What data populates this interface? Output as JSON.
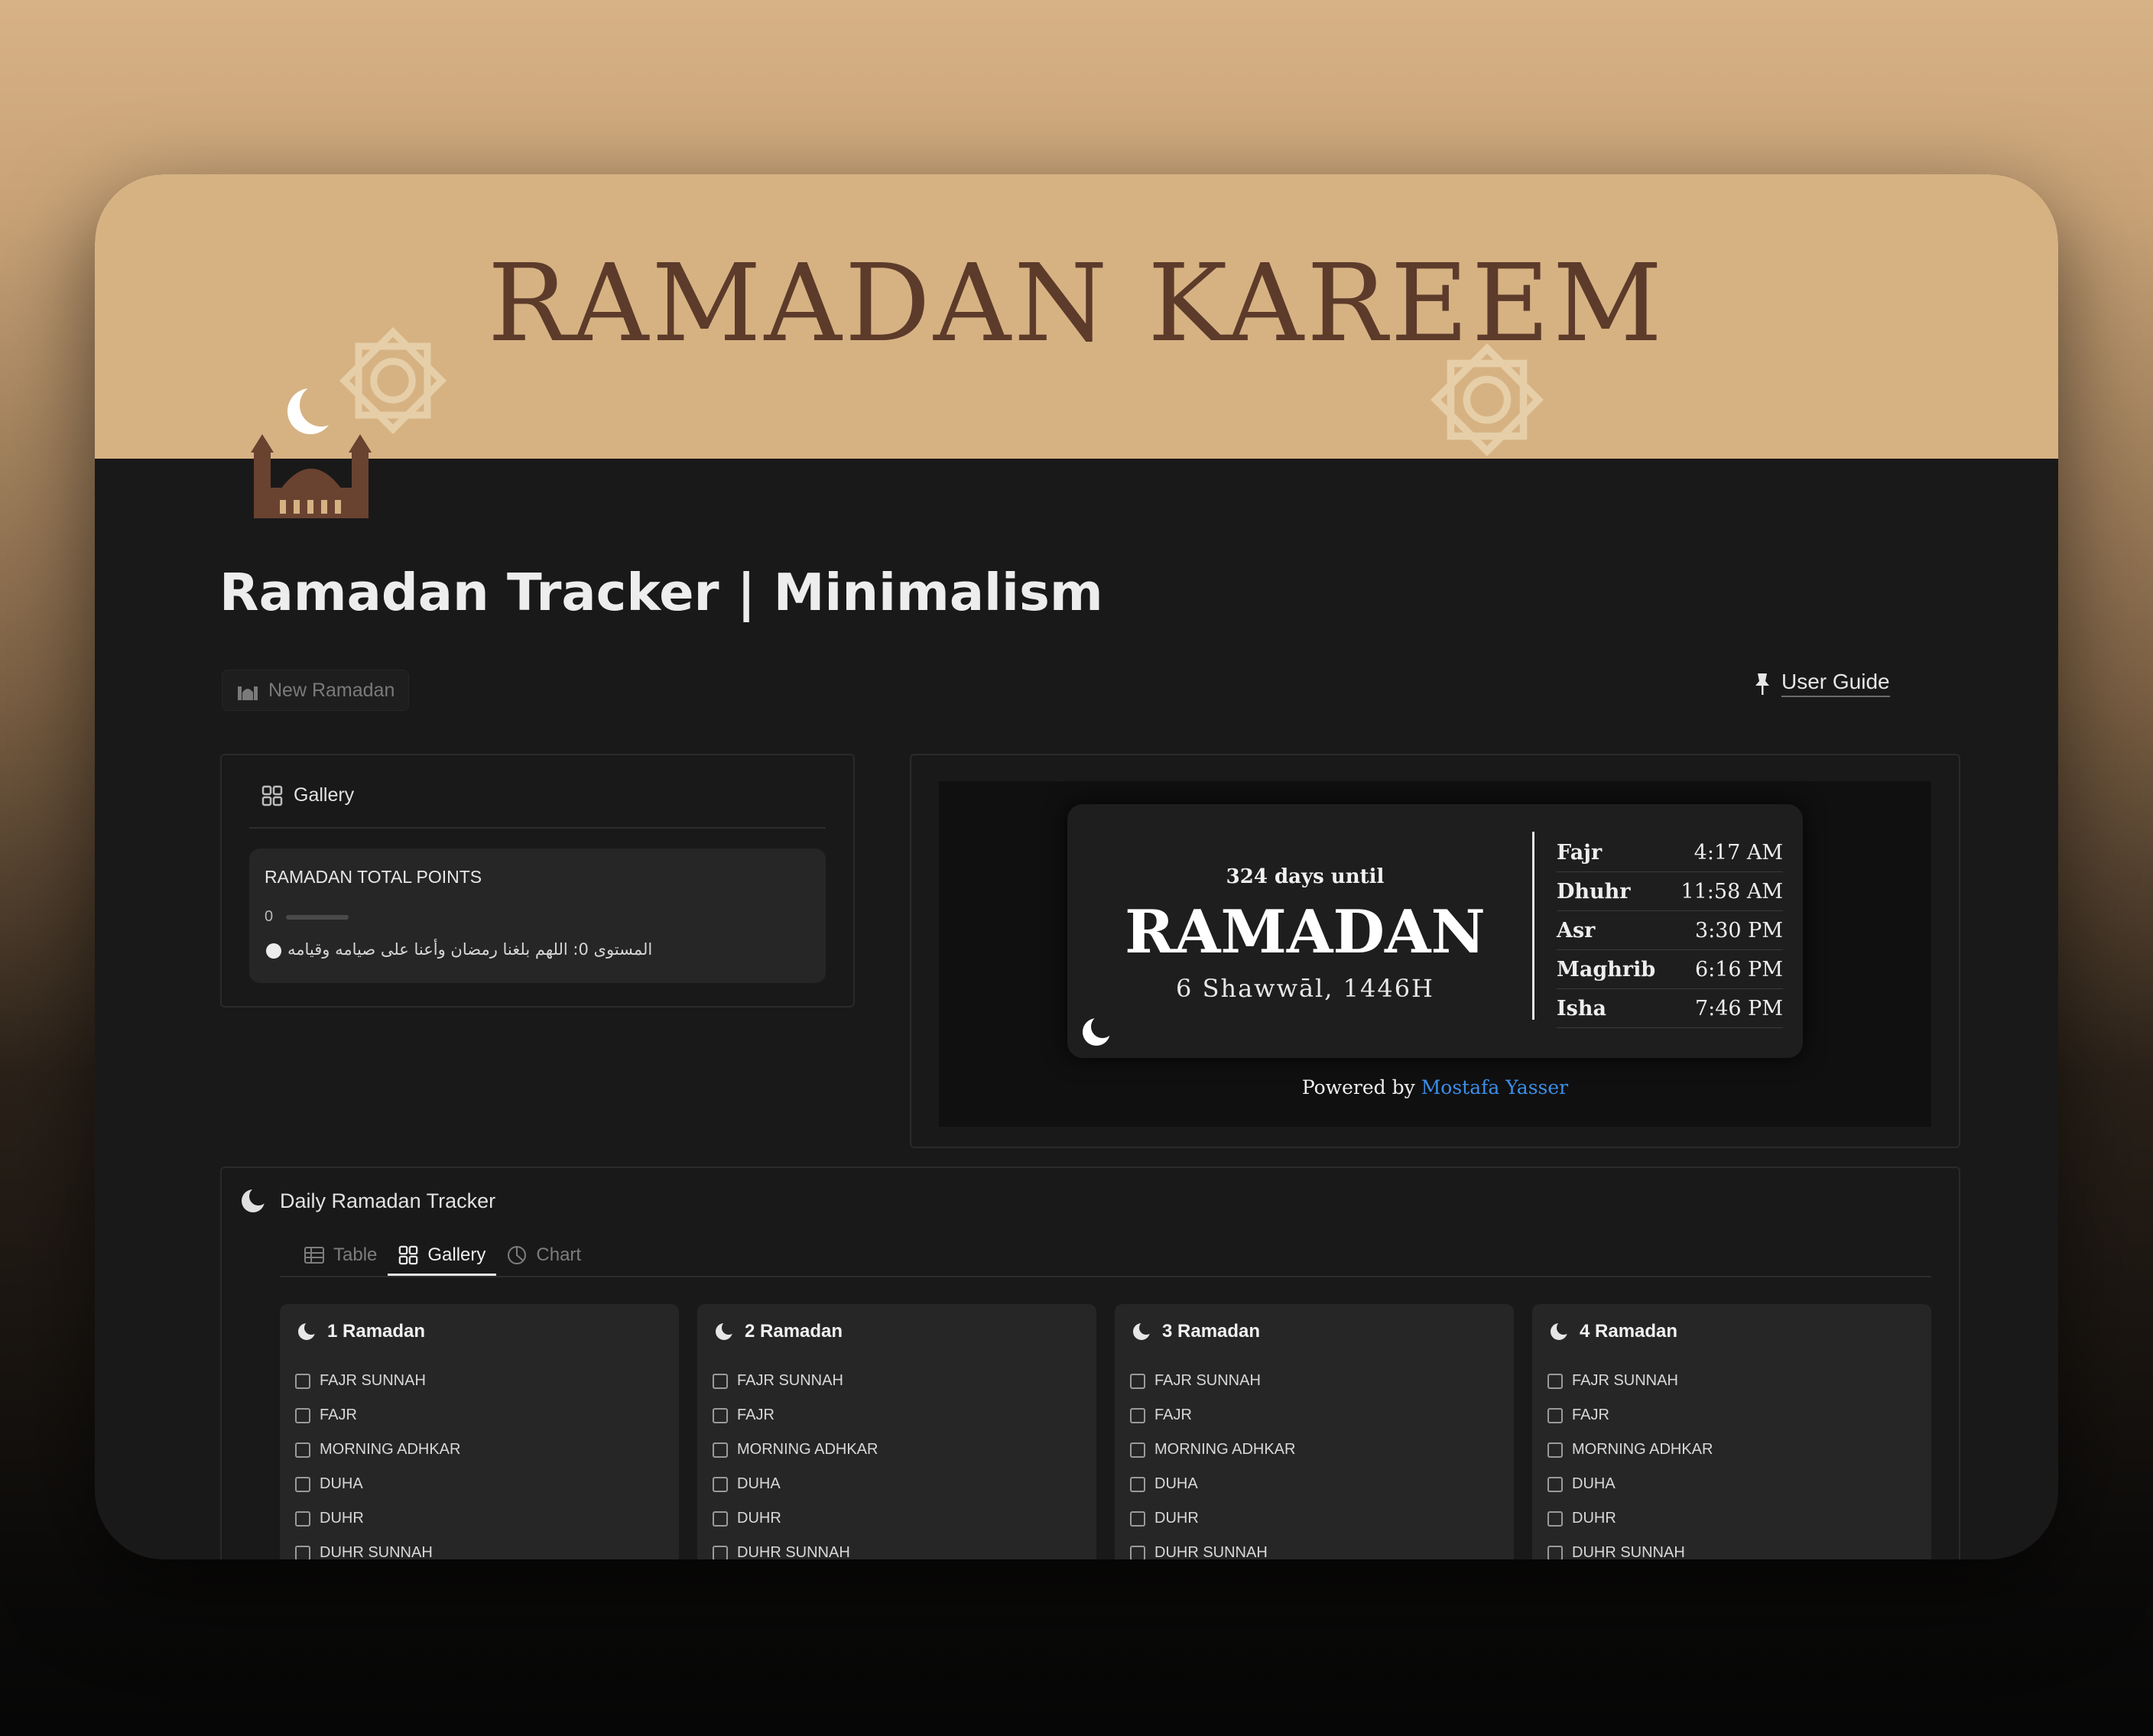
{
  "banner": {
    "title": "RAMADAN KAREEM"
  },
  "page": {
    "title": "Ramadan Tracker | Minimalism"
  },
  "actions": {
    "new_button": "New Ramadan",
    "guide_link": "User Guide"
  },
  "gallery_panel": {
    "view_label": "Gallery",
    "card_title": "RAMADAN TOTAL POINTS",
    "points_value": "0",
    "points_progress": 0,
    "level_text": "المستوى 0: اللهم بلغنا رمضان وأعنا على صيامه وقيامه"
  },
  "countdown": {
    "days_text": "324 days until",
    "event": "RAMADAN",
    "hijri_date": "6 Shawwāl, 1446H",
    "prayer_times": [
      {
        "name": "Fajr",
        "time": "4:17 AM"
      },
      {
        "name": "Dhuhr",
        "time": "11:58 AM"
      },
      {
        "name": "Asr",
        "time": "3:30 PM"
      },
      {
        "name": "Maghrib",
        "time": "6:16 PM"
      },
      {
        "name": "Isha",
        "time": "7:46 PM"
      }
    ],
    "powered_prefix": "Powered by",
    "powered_author": "Mostafa Yasser"
  },
  "tracker": {
    "title": "Daily Ramadan Tracker",
    "tabs": [
      {
        "label": "Table"
      },
      {
        "label": "Gallery"
      },
      {
        "label": "Chart"
      }
    ],
    "active_tab": "Gallery",
    "cards": [
      {
        "title": "1 Ramadan",
        "items": [
          "FAJR SUNNAH",
          "FAJR",
          "MORNING ADHKAR",
          "DUHA",
          "DUHR",
          "DUHR SUNNAH"
        ]
      },
      {
        "title": "2 Ramadan",
        "items": [
          "FAJR SUNNAH",
          "FAJR",
          "MORNING ADHKAR",
          "DUHA",
          "DUHR",
          "DUHR SUNNAH"
        ]
      },
      {
        "title": "3 Ramadan",
        "items": [
          "FAJR SUNNAH",
          "FAJR",
          "MORNING ADHKAR",
          "DUHA",
          "DUHR",
          "DUHR SUNNAH"
        ]
      },
      {
        "title": "4 Ramadan",
        "items": [
          "FAJR SUNNAH",
          "FAJR",
          "MORNING ADHKAR",
          "DUHA",
          "DUHR",
          "DUHR SUNNAH"
        ]
      }
    ]
  },
  "colors": {
    "banner": "#d6b283",
    "page_bg": "#191919",
    "accent_link": "#3b8ee8",
    "title_brown": "#5c3b2b"
  },
  "icons": [
    "mosque-icon",
    "crescent-moon-icon",
    "pin-icon",
    "gallery-grid-icon",
    "table-icon",
    "chart-icon",
    "checkbox-icon"
  ]
}
